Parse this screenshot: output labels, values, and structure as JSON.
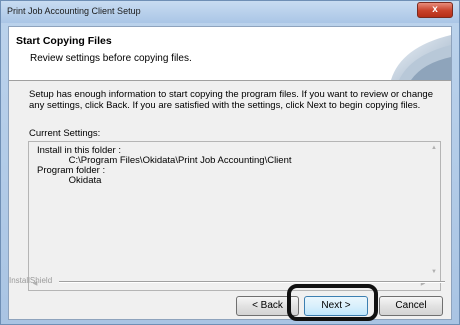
{
  "window": {
    "title": "Print Job Accounting Client Setup",
    "close_glyph": "x"
  },
  "header": {
    "title": "Start Copying Files",
    "subtitle": "Review settings before copying files.",
    "art_icon": "installshield-banner-graphic"
  },
  "body": {
    "description": "Setup has enough information to start copying the program files.  If you want to review or change any settings, click Back.  If you are satisfied with the settings, click Next to begin copying files.",
    "current_settings_label": "Current Settings:",
    "settings_text": "Install in this folder :\n            C:\\Program Files\\Okidata\\Print Job Accounting\\Client\nProgram folder :\n            Okidata"
  },
  "footer": {
    "brand": "InstallShield",
    "back_label": "< Back",
    "next_label": "Next >",
    "cancel_label": "Cancel"
  },
  "colors": {
    "accent_highlight": "#111111",
    "close_button": "#c8412a"
  }
}
